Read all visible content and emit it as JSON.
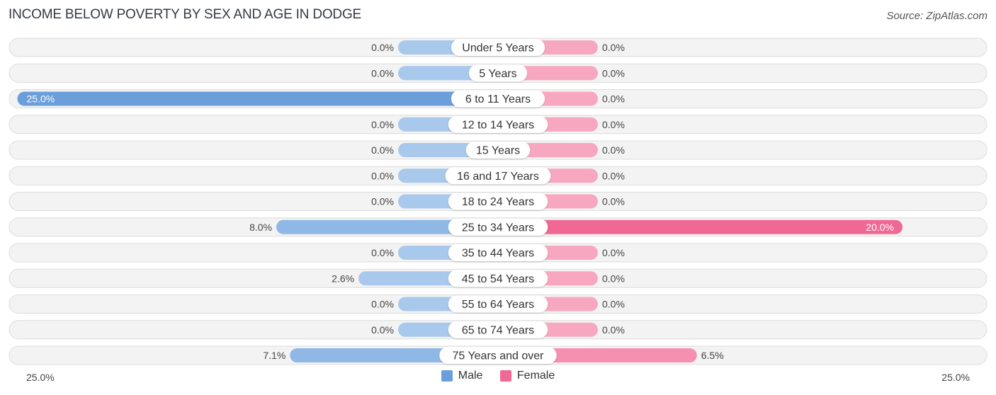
{
  "chart_data": {
    "type": "bar",
    "orientation": "horizontal-diverging",
    "title": "INCOME BELOW POVERTY BY SEX AND AGE IN DODGE",
    "source": "Source: ZipAtlas.com",
    "categories": [
      "Under 5 Years",
      "5 Years",
      "6 to 11 Years",
      "12 to 14 Years",
      "15 Years",
      "16 and 17 Years",
      "18 to 24 Years",
      "25 to 34 Years",
      "35 to 44 Years",
      "45 to 54 Years",
      "55 to 64 Years",
      "65 to 74 Years",
      "75 Years and over"
    ],
    "series": [
      {
        "name": "Male",
        "color": "#6a9fdb",
        "values": [
          0.0,
          0.0,
          25.0,
          0.0,
          0.0,
          0.0,
          0.0,
          8.0,
          0.0,
          2.6,
          0.0,
          0.0,
          7.1
        ]
      },
      {
        "name": "Female",
        "color": "#f06894",
        "values": [
          0.0,
          0.0,
          0.0,
          0.0,
          0.0,
          0.0,
          0.0,
          20.0,
          0.0,
          0.0,
          0.0,
          0.0,
          6.5
        ]
      }
    ],
    "value_labels": {
      "male": [
        "0.0%",
        "0.0%",
        "25.0%",
        "0.0%",
        "0.0%",
        "0.0%",
        "0.0%",
        "8.0%",
        "0.0%",
        "2.6%",
        "0.0%",
        "0.0%",
        "7.1%"
      ],
      "female": [
        "0.0%",
        "0.0%",
        "0.0%",
        "0.0%",
        "0.0%",
        "0.0%",
        "0.0%",
        "20.0%",
        "0.0%",
        "0.0%",
        "0.0%",
        "0.0%",
        "6.5%"
      ]
    },
    "xlim": [
      -25,
      25
    ],
    "axis_labels": {
      "left": "25.0%",
      "right": "25.0%"
    },
    "legend": {
      "position": "bottom-center",
      "entries": [
        "Male",
        "Female"
      ]
    },
    "grid": false
  }
}
